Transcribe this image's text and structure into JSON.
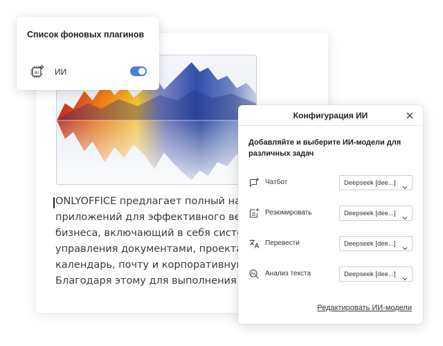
{
  "document": {
    "paragraph_lines": [
      "ONLYOFFICE предлагает полный наб",
      "приложений для эффективного вед",
      "бизнеса, включающий в себя систе",
      "управления документами, проектам",
      "календарь, почту и корпоративную",
      "Благодаря этому для выполнения р"
    ]
  },
  "plugins_panel": {
    "title": "Список фоновых плагинов",
    "plugins": [
      {
        "name": "ИИ",
        "icon": "ai-chip-icon",
        "enabled": true
      }
    ],
    "toggle_color": "#4a7fe0"
  },
  "config_dialog": {
    "title": "Конфигурация ИИ",
    "description": "Добавляйте и выберите ИИ-модели для различных задач",
    "tasks": [
      {
        "label": "Чатбот",
        "icon": "chat-icon",
        "model": "Deepseek [dee...]"
      },
      {
        "label": "Резюмировать",
        "icon": "summarize-icon",
        "model": "Deepseek [dee...]"
      },
      {
        "label": "Перевести",
        "icon": "translate-icon",
        "model": "Deepseek [dee...]"
      },
      {
        "label": "Анализ текста",
        "icon": "text-analysis-icon",
        "model": "Deepseek [dee...]"
      }
    ],
    "edit_link": "Редактировать ИИ-модели"
  }
}
